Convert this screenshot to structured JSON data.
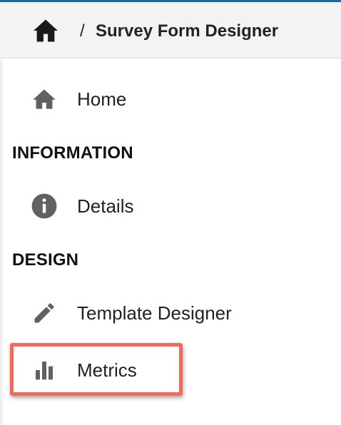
{
  "header": {
    "home_icon": "home-icon",
    "separator": "/",
    "title": "Survey Form Designer"
  },
  "sidebar": {
    "items": [
      {
        "label": "Home",
        "icon": "home-icon"
      }
    ],
    "sections": [
      {
        "title": "INFORMATION",
        "items": [
          {
            "label": "Details",
            "icon": "info-icon"
          }
        ]
      },
      {
        "title": "DESIGN",
        "items": [
          {
            "label": "Template Designer",
            "icon": "pencil-icon"
          },
          {
            "label": "Metrics",
            "icon": "bar-chart-icon",
            "highlighted": true
          }
        ]
      }
    ]
  },
  "colors": {
    "accent_bar": "#1e6aa0",
    "header_bg": "#f3f3f3",
    "icon_gray": "#616161",
    "highlight": "#f4685c"
  }
}
